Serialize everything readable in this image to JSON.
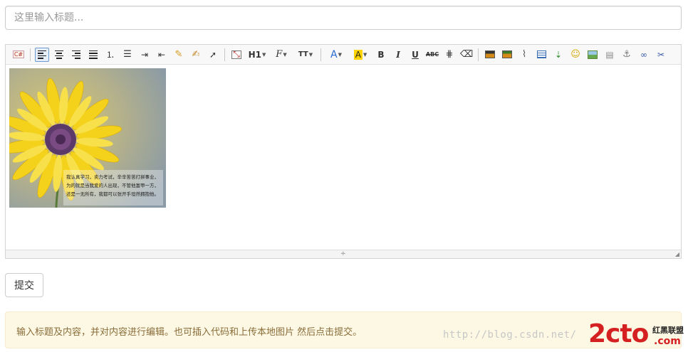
{
  "title_field": {
    "placeholder": "这里输入标题...",
    "value": ""
  },
  "toolbar": {
    "heading_label": "H1",
    "font_label": "F",
    "size_label": "TT",
    "bold_label": "B",
    "italic_label": "I",
    "underline_label": "U",
    "strike_label": "ABC",
    "code_label": "C#",
    "font_color_label": "A",
    "bg_color_label": "A"
  },
  "image_caption": "我认真学习，卖力考试，辛辛苦苦打拼事业，为的就是当我爱的人出现，不管他富甲一方，还是一无所有，我都可以张开手坦然拥抱他。",
  "submit_label": "提交",
  "alert_text": "输入标题及内容，并对内容进行编辑。也可插入代码和上传本地图片 然后点击提交。",
  "watermark_text": "http://blog.csdn.net/",
  "logo": {
    "main": "2cto",
    "suffix": ".com",
    "tag": "红黑联盟"
  },
  "colors": {
    "alert_bg": "#fcf8e3",
    "alert_text": "#8a6d3b",
    "logo_red": "#d42020"
  }
}
